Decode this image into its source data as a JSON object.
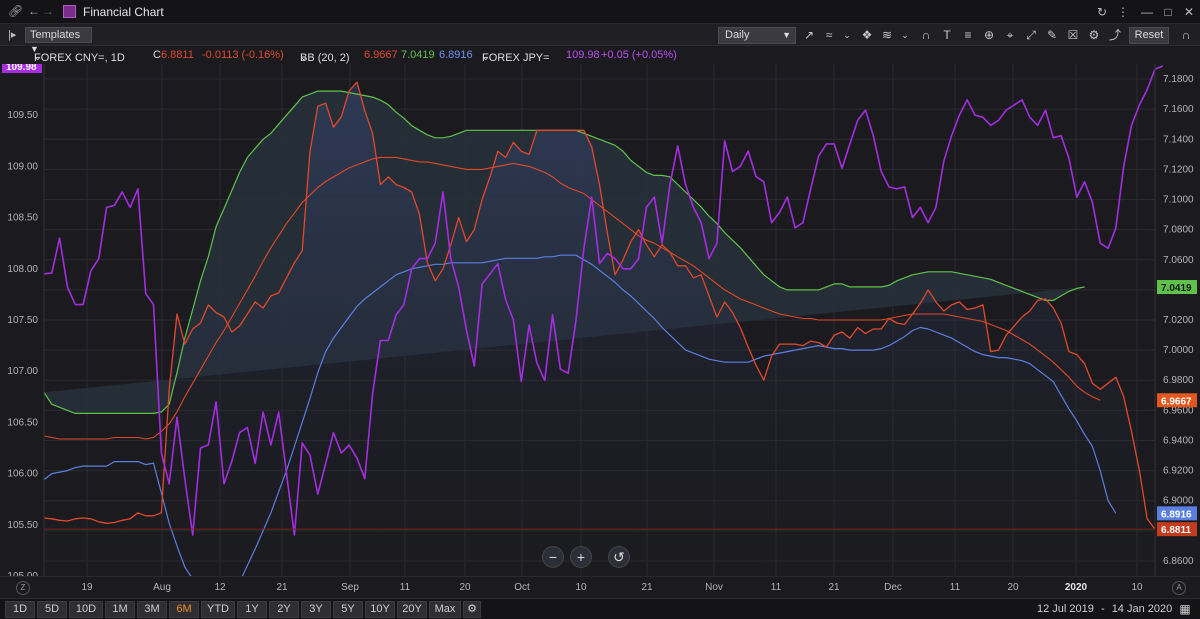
{
  "titlebar": {
    "title": "Financial Chart"
  },
  "toolbar": {
    "templates_label": "Templates",
    "interval_value": "Daily",
    "reset_label": "Reset",
    "tools": [
      "line-chart-icon",
      "indicator-icon",
      "chevron-down-icon",
      "compare-icon",
      "wave-icon",
      "chevron-down-icon",
      "magnet-icon",
      "text-icon",
      "fib-icon",
      "zoom-icon",
      "crosshair-icon",
      "fit-icon",
      "annotation-icon",
      "delete-drawings-icon",
      "settings-icon",
      "share-icon"
    ]
  },
  "legend": {
    "ric": "FOREX CNY=, 1D",
    "close_prefix": "C",
    "close_value": "6.8811",
    "close_change": "-0.0113 (-0.16%)",
    "bb_label": "BB (20, 2)",
    "bb_mid": "6.9667",
    "bb_upper": "7.0419",
    "bb_lower": "6.8916",
    "jpy_label": "FOREX JPY=",
    "jpy_value": "109.98",
    "jpy_change": "+0.05 (+0.05%)"
  },
  "colors": {
    "cny": "#e0492a",
    "bb_mid": "#e0492a",
    "bb_upper": "#5fc24b",
    "bb_lower": "#5b7fe0",
    "jpy": "#a52de0",
    "background": "#1b1b1f"
  },
  "axes": {
    "left_ticks": [
      "110.00",
      "109.50",
      "109.00",
      "108.50",
      "108.00",
      "107.50",
      "107.00",
      "106.50",
      "106.00",
      "105.50",
      "105.00"
    ],
    "right_ticks": [
      "7.1800",
      "7.1600",
      "7.1400",
      "7.1200",
      "7.1000",
      "7.0800",
      "7.0600",
      "7.0400",
      "7.0200",
      "7.0000",
      "6.9800",
      "6.9600",
      "6.9400",
      "6.9200",
      "6.9000",
      "6.8800",
      "6.8600"
    ],
    "left_badge": "109.98",
    "right_badges": {
      "upper": "7.0419",
      "mid": "6.9667",
      "lower": "6.8916",
      "last": "6.8811"
    },
    "x_labels": [
      "19",
      "Aug",
      "12",
      "21",
      "Sep",
      "11",
      "20",
      "Oct",
      "10",
      "21",
      "Nov",
      "11",
      "21",
      "Dec",
      "11",
      "20",
      "2020",
      "10"
    ],
    "x_year_label": "2020"
  },
  "chart_data": {
    "type": "line",
    "x_start": "12 Jul 2019",
    "x_end": "14 Jan 2020",
    "series": [
      {
        "name": "FOREX CNY=",
        "axis": "right",
        "values": [
          6.8885,
          6.888,
          6.887,
          6.8865,
          6.888,
          6.8885,
          6.888,
          6.886,
          6.885,
          6.8855,
          6.887,
          6.888,
          6.892,
          6.89,
          6.89,
          6.892,
          6.974,
          7.024,
          7.004,
          7.014,
          7.018,
          7.03,
          7.025,
          7.022,
          7.012,
          7.016,
          7.024,
          7.032,
          7.028,
          7.036,
          7.038,
          7.048,
          7.058,
          7.066,
          7.132,
          7.162,
          7.164,
          7.148,
          7.155,
          7.172,
          7.178,
          7.159,
          7.144,
          7.11,
          7.115,
          7.11,
          7.108,
          7.105,
          7.09,
          7.058,
          7.046,
          7.054,
          7.07,
          7.088,
          7.072,
          7.08,
          7.1,
          7.115,
          7.132,
          7.128,
          7.138,
          7.132,
          7.13,
          7.146,
          7.146,
          7.146,
          7.146,
          7.146,
          7.146,
          7.146,
          7.135,
          7.11,
          7.078,
          7.05,
          7.06,
          7.072,
          7.08,
          7.07,
          7.062,
          7.07,
          7.065,
          7.056,
          7.056,
          7.048,
          7.05,
          7.036,
          7.022,
          7.032,
          7.025,
          7.015,
          7.002,
          6.99,
          6.98,
          6.996,
          7.004,
          7.004,
          7.004,
          7.003,
          7.006,
          7.005,
          7.002,
          7.01,
          7.012,
          7.008,
          7.015,
          7.011,
          7.014,
          7.014,
          7.021,
          7.018,
          7.017,
          7.024,
          7.031,
          7.04,
          7.032,
          7.026,
          7.03,
          7.032,
          7.027,
          7.028,
          7.03,
          6.999,
          7.0,
          7.01,
          7.016,
          7.022,
          7.026,
          7.033,
          7.034,
          7.028,
          7.018,
          6.999,
          6.997,
          6.991,
          6.978,
          6.974,
          6.978,
          6.982,
          6.969,
          6.946,
          6.92,
          6.888,
          6.8811
        ]
      },
      {
        "name": "BB upper",
        "axis": "right",
        "values": [
          6.972,
          6.964,
          6.962,
          6.96,
          6.958,
          6.958,
          6.958,
          6.958,
          6.958,
          6.958,
          6.958,
          6.958,
          6.958,
          6.958,
          6.958,
          6.959,
          6.964,
          6.985,
          7.008,
          7.027,
          7.046,
          7.062,
          7.082,
          7.094,
          7.106,
          7.118,
          7.128,
          7.134,
          7.14,
          7.144,
          7.15,
          7.156,
          7.162,
          7.168,
          7.17,
          7.172,
          7.172,
          7.172,
          7.172,
          7.171,
          7.17,
          7.169,
          7.168,
          7.166,
          7.163,
          7.158,
          7.154,
          7.149,
          7.146,
          7.143,
          7.141,
          7.141,
          7.142,
          7.144,
          7.146,
          7.146,
          7.146,
          7.146,
          7.146,
          7.146,
          7.146,
          7.146,
          7.146,
          7.146,
          7.146,
          7.146,
          7.146,
          7.146,
          7.146,
          7.144,
          7.142,
          7.14,
          7.138,
          7.136,
          7.132,
          7.126,
          7.122,
          7.118,
          7.116,
          7.116,
          7.115,
          7.11,
          7.105,
          7.1,
          7.095,
          7.089,
          7.084,
          7.078,
          7.073,
          7.068,
          7.062,
          7.056,
          7.05,
          7.046,
          7.042,
          7.04,
          7.04,
          7.04,
          7.04,
          7.04,
          7.042,
          7.044,
          7.044,
          7.042,
          7.042,
          7.042,
          7.042,
          7.042,
          7.043,
          7.046,
          7.048,
          7.05,
          7.051,
          7.052,
          7.052,
          7.052,
          7.052,
          7.051,
          7.05,
          7.049,
          7.048,
          7.047,
          7.045,
          7.043,
          7.041,
          7.039,
          7.037,
          7.035,
          7.033,
          7.033,
          7.036,
          7.039,
          7.041,
          7.0419
        ]
      },
      {
        "name": "BB mid",
        "axis": "right",
        "values": [
          6.943,
          6.942,
          6.941,
          6.941,
          6.941,
          6.941,
          6.941,
          6.941,
          6.941,
          6.942,
          6.942,
          6.942,
          6.942,
          6.941,
          6.942,
          6.946,
          6.951,
          6.959,
          6.969,
          6.978,
          6.987,
          6.996,
          7.005,
          7.013,
          7.022,
          7.031,
          7.04,
          7.049,
          7.059,
          7.068,
          7.076,
          7.084,
          7.091,
          7.098,
          7.103,
          7.108,
          7.112,
          7.115,
          7.118,
          7.121,
          7.123,
          7.125,
          7.127,
          7.128,
          7.128,
          7.128,
          7.127,
          7.126,
          7.125,
          7.125,
          7.124,
          7.123,
          7.122,
          7.121,
          7.12,
          7.12,
          7.12,
          7.121,
          7.122,
          7.123,
          7.124,
          7.123,
          7.122,
          7.12,
          7.118,
          7.115,
          7.111,
          7.108,
          7.106,
          7.104,
          7.1,
          7.096,
          7.092,
          7.088,
          7.084,
          7.08,
          7.076,
          7.073,
          7.071,
          7.068,
          7.065,
          7.062,
          7.059,
          7.056,
          7.052,
          7.048,
          7.044,
          7.04,
          7.037,
          7.034,
          7.032,
          7.03,
          7.028,
          7.026,
          7.024,
          7.023,
          7.022,
          7.021,
          7.021,
          7.02,
          7.02,
          7.02,
          7.02,
          7.02,
          7.02,
          7.02,
          7.02,
          7.02,
          7.021,
          7.022,
          7.023,
          7.024,
          7.024,
          7.024,
          7.024,
          7.024,
          7.023,
          7.022,
          7.021,
          7.02,
          7.019,
          7.017,
          7.015,
          7.013,
          7.01,
          7.007,
          7.004,
          7.0,
          6.996,
          6.992,
          6.987,
          6.982,
          6.976,
          6.972,
          6.969,
          6.9667
        ]
      },
      {
        "name": "BB lower",
        "axis": "right",
        "values": [
          6.914,
          6.918,
          6.919,
          6.92,
          6.922,
          6.923,
          6.923,
          6.923,
          6.923,
          6.926,
          6.926,
          6.926,
          6.926,
          6.924,
          6.925,
          6.905,
          6.885,
          6.87,
          6.856,
          6.848,
          6.84,
          6.835,
          6.83,
          6.832,
          6.838,
          6.846,
          6.857,
          6.868,
          6.88,
          6.892,
          6.906,
          6.92,
          6.936,
          6.952,
          6.968,
          6.985,
          6.999,
          7.008,
          7.015,
          7.022,
          7.029,
          7.034,
          7.038,
          7.042,
          7.046,
          7.05,
          7.052,
          7.054,
          7.055,
          7.056,
          7.057,
          7.057,
          7.058,
          7.058,
          7.058,
          7.058,
          7.058,
          7.059,
          7.06,
          7.061,
          7.061,
          7.061,
          7.061,
          7.061,
          7.062,
          7.062,
          7.063,
          7.063,
          7.063,
          7.06,
          7.057,
          7.053,
          7.049,
          7.045,
          7.04,
          7.036,
          7.031,
          7.026,
          7.021,
          7.015,
          7.01,
          7.005,
          7.0,
          6.998,
          6.996,
          6.994,
          6.993,
          6.992,
          6.992,
          6.992,
          6.992,
          6.994,
          6.996,
          6.997,
          6.998,
          6.999,
          7.0,
          7.001,
          7.002,
          7.003,
          7.002,
          7.001,
          7.001,
          7.0,
          7.0,
          7.0,
          7.0,
          7.001,
          7.003,
          7.006,
          7.009,
          7.013,
          7.015,
          7.014,
          7.012,
          7.01,
          7.008,
          7.005,
          7.002,
          6.999,
          6.997,
          6.996,
          6.995,
          6.995,
          6.994,
          6.993,
          6.991,
          6.987,
          6.983,
          6.979,
          6.97,
          6.961,
          6.953,
          6.944,
          6.936,
          6.92,
          6.9,
          6.8916
        ]
      },
      {
        "name": "FOREX JPY=",
        "axis": "left",
        "values": [
          107.95,
          107.96,
          108.3,
          107.82,
          107.65,
          107.65,
          107.98,
          108.1,
          108.6,
          108.62,
          108.75,
          108.6,
          108.78,
          107.76,
          107.65,
          106.2,
          105.9,
          106.55,
          105.95,
          105.4,
          106.25,
          106.28,
          106.7,
          105.9,
          106.12,
          106.4,
          106.45,
          106.1,
          106.6,
          106.28,
          106.6,
          106.0,
          105.4,
          106.3,
          106.18,
          105.8,
          106.1,
          106.4,
          106.2,
          106.28,
          106.15,
          105.95,
          106.78,
          107.3,
          107.3,
          107.55,
          107.65,
          108.0,
          108.1,
          108.1,
          108.25,
          108.75,
          108.1,
          107.82,
          107.4,
          107.05,
          107.85,
          107.95,
          108.05,
          107.7,
          107.5,
          106.9,
          107.45,
          107.08,
          106.91,
          107.55,
          107.02,
          106.98,
          107.5,
          108.2,
          108.7,
          108.05,
          108.15,
          108.1,
          108.0,
          108.0,
          108.1,
          108.6,
          108.7,
          108.25,
          108.82,
          109.2,
          108.82,
          108.6,
          108.45,
          108.1,
          108.25,
          109.25,
          108.95,
          109.0,
          109.15,
          108.9,
          108.85,
          108.45,
          108.55,
          108.7,
          108.4,
          108.45,
          108.78,
          109.1,
          109.22,
          109.22,
          108.98,
          109.22,
          109.45,
          109.55,
          109.3,
          108.95,
          108.8,
          108.78,
          108.8,
          108.5,
          108.6,
          108.45,
          108.6,
          109.05,
          109.3,
          109.5,
          109.65,
          109.5,
          109.48,
          109.4,
          109.45,
          109.55,
          109.6,
          109.65,
          109.48,
          109.4,
          109.55,
          109.28,
          109.3,
          109.08,
          108.7,
          108.85,
          108.65,
          108.25,
          108.2,
          108.4,
          109.0,
          109.4,
          109.6,
          109.75,
          109.95,
          109.98
        ]
      }
    ],
    "left_range": [
      105.0,
      110.0
    ],
    "right_range": [
      6.85,
      7.19
    ],
    "grid": true
  },
  "bottombar": {
    "ranges": [
      "1D",
      "5D",
      "10D",
      "1M",
      "3M",
      "6M",
      "YTD",
      "1Y",
      "2Y",
      "3Y",
      "5Y",
      "10Y",
      "20Y",
      "Max"
    ],
    "active_range": "6M",
    "date_from": "12 Jul 2019",
    "date_sep": "-",
    "date_to": "14 Jan 2020"
  }
}
